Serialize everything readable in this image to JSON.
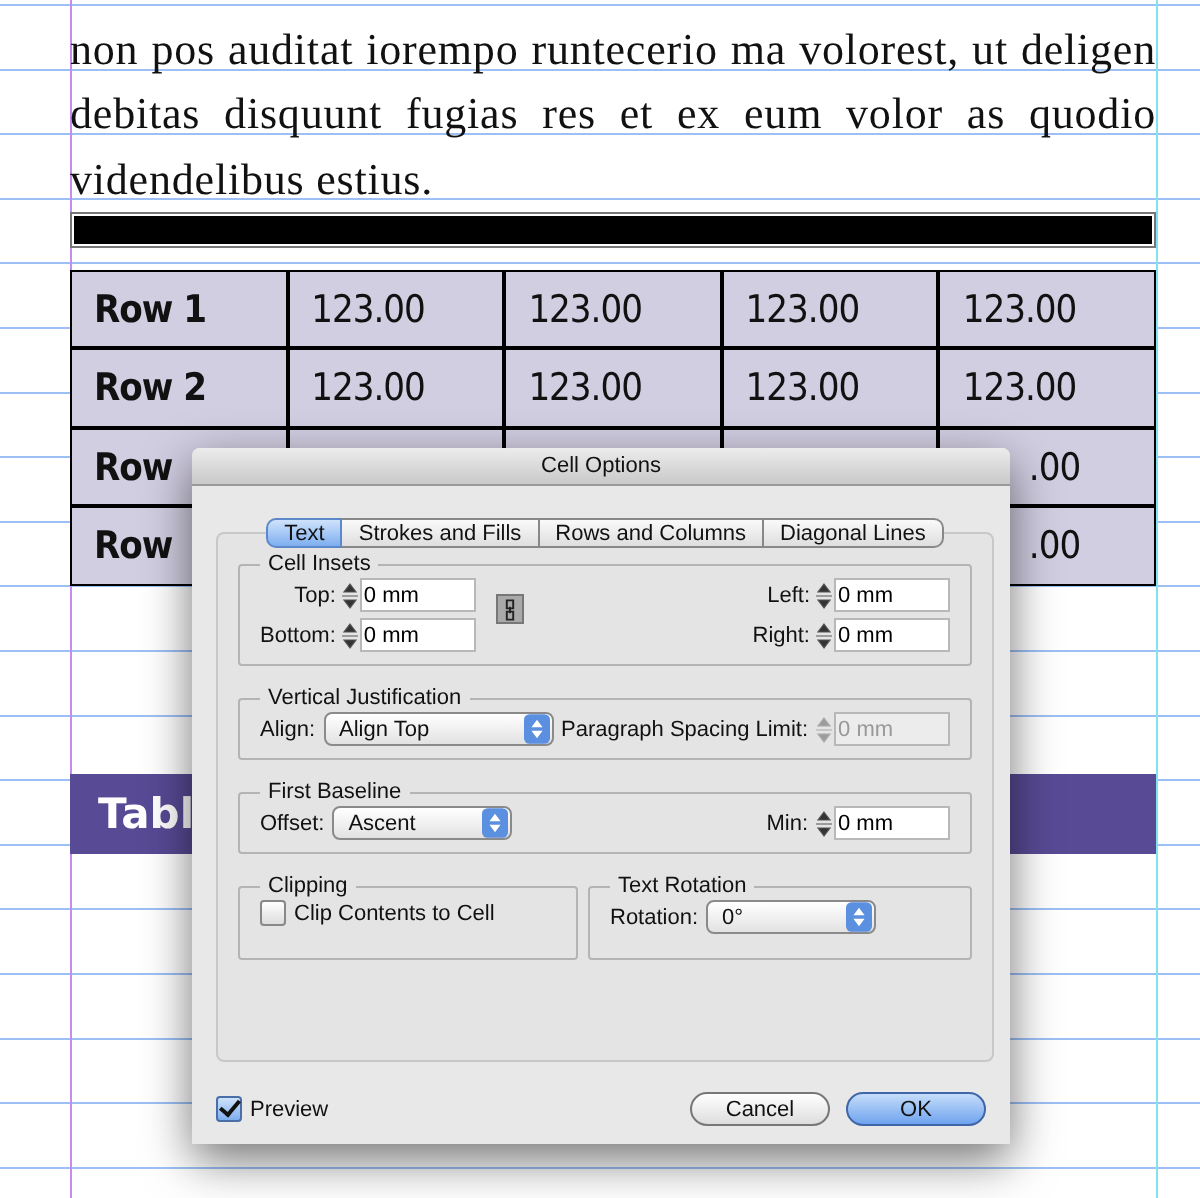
{
  "document": {
    "paragraph_lines": [
      "non pos auditat iorempo runtecerio ma volorest, ut deligen",
      "debitas disquunt fugias res et ex eum volor as quodio",
      "videndelibus estius."
    ],
    "table": {
      "rows": [
        {
          "label": "Row 1",
          "cells": [
            "123.00",
            "123.00",
            "123.00",
            "123.00"
          ]
        },
        {
          "label": "Row 2",
          "cells": [
            "123.00",
            "123.00",
            "123.00",
            "123.00"
          ]
        },
        {
          "label": "Row",
          "cells": [
            "",
            "",
            "",
            ".00"
          ]
        },
        {
          "label": "Row",
          "cells": [
            "",
            "",
            "",
            ".00"
          ]
        }
      ]
    },
    "header_bar": "Tabl"
  },
  "dialog": {
    "title": "Cell Options",
    "tabs": [
      {
        "label": "Text",
        "selected": true
      },
      {
        "label": "Strokes and Fills",
        "selected": false
      },
      {
        "label": "Rows and Columns",
        "selected": false
      },
      {
        "label": "Diagonal Lines",
        "selected": false
      }
    ],
    "cell_insets": {
      "title": "Cell Insets",
      "left_fields": [
        {
          "label": "Top:",
          "value": "0 mm"
        },
        {
          "label": "Bottom:",
          "value": "0 mm"
        }
      ],
      "right_fields": [
        {
          "label": "Left:",
          "value": "0 mm"
        },
        {
          "label": "Right:",
          "value": "0 mm"
        }
      ]
    },
    "vertical_justification": {
      "title": "Vertical Justification",
      "align_label": "Align:",
      "align_value": "Align Top",
      "spacing_label": "Paragraph Spacing Limit:",
      "spacing_value": "0 mm",
      "spacing_disabled": true
    },
    "first_baseline": {
      "title": "First Baseline",
      "offset_label": "Offset:",
      "offset_value": "Ascent",
      "min_label": "Min:",
      "min_value": "0 mm"
    },
    "clipping": {
      "title": "Clipping",
      "checkbox_label": "Clip Contents to Cell",
      "checked": false
    },
    "text_rotation": {
      "title": "Text Rotation",
      "rotation_label": "Rotation:",
      "rotation_value": "0°"
    },
    "preview": {
      "label": "Preview",
      "checked": true
    },
    "buttons": [
      {
        "label": "Cancel",
        "default": false
      },
      {
        "label": "OK",
        "default": true
      }
    ]
  }
}
